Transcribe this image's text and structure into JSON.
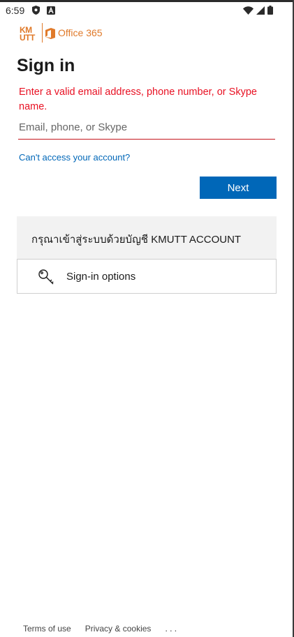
{
  "status_bar": {
    "time": "6:59",
    "icons_left": [
      "shield-icon",
      "a-box-icon"
    ],
    "icons_right": [
      "wifi-icon",
      "cellular-icon",
      "battery-icon"
    ]
  },
  "logo": {
    "kmutt_text": "KMUTT",
    "office_text": "Office 365",
    "accent_color": "#e07a2a"
  },
  "page_title": "Sign in",
  "error_message": "Enter a valid email address, phone number, or Skype name.",
  "email_field": {
    "placeholder": "Email, phone, or Skype",
    "value": ""
  },
  "cant_access_link": "Can't access your account?",
  "next_button": "Next",
  "banner_text": "กรุณาเข้าสู่ระบบด้วยบัญชี KMUTT ACCOUNT",
  "signin_options_label": "Sign-in options",
  "footer": {
    "terms": "Terms of use",
    "privacy": "Privacy & cookies",
    "more": "..."
  },
  "colors": {
    "primary": "#0067b8",
    "error": "#e81123",
    "banner_bg": "#f2f2f2"
  }
}
